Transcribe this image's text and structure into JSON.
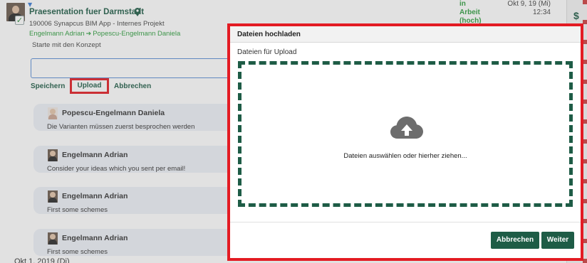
{
  "task": {
    "title": "Praesentation fuer Darmstadt",
    "project": "190006 Synapcus BIM App - Internes Projekt",
    "from": "Engelmann Adrian",
    "to": "Popescu-Engelmann Daniela",
    "description": "Starte mit den Konzept",
    "status_lines": [
      "in",
      "Arbeit",
      "(hoch)"
    ],
    "date": "Okt 9, 19 (Mi)",
    "time": "12:34"
  },
  "comment_actions": {
    "save_label": "Speichern",
    "upload_label": "Upload",
    "cancel_label": "Abbrechen"
  },
  "comments": [
    {
      "author": "Popescu-Engelmann Daniela",
      "text": "Die Varianten müssen zuerst besprochen werden"
    },
    {
      "author": "Engelmann Adrian",
      "text": "Consider your ideas which you sent per email!"
    },
    {
      "author": "Engelmann Adrian",
      "text": "First some schemes"
    },
    {
      "author": "Engelmann Adrian",
      "text": "First some schemes"
    }
  ],
  "next_date_partial": "Okt 1, 2019 (Di)",
  "side_panel": {
    "symbol": "$"
  },
  "modal": {
    "title": "Dateien hochladen",
    "upload_label": "Dateien für Upload",
    "dropzone_text": "Dateien auswählen oder hierher ziehen...",
    "cancel_label": "Abbrechen",
    "next_label": "Weiter"
  },
  "colors": {
    "brand_green": "#1e5c46",
    "status_green": "#2e9e3e",
    "highlight_red": "#e31b23"
  },
  "icons": {
    "upload": "cloud-upload-icon",
    "location": "map-pin-icon",
    "done": "checkmark-icon"
  }
}
